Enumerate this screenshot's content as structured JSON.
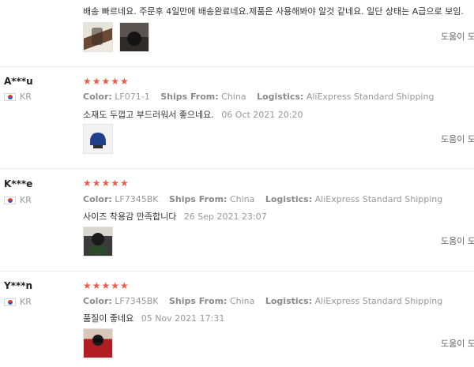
{
  "reviews": [
    {
      "user": "",
      "country": "",
      "attributes": [],
      "text": "배송 빠르네요. 주문후 4일만에 배송완료네요.제품은 사용해봐야 알것 같네요. 일단 상태는 A급으로 보임.",
      "date": "",
      "helpful_label": "도움이 도",
      "photos": [
        "photo-1",
        "photo-2"
      ]
    },
    {
      "user": "A***u",
      "country": "KR",
      "stars": "★★★★★",
      "attributes": [
        {
          "key": "Color:",
          "value": "LF071-1"
        },
        {
          "key": "Ships From:",
          "value": "China"
        },
        {
          "key": "Logistics:",
          "value": "AliExpress Standard Shipping"
        }
      ],
      "text": "소재도 두껍고 부드러워서 좋으네요.",
      "date": "06 Oct 2021 20:20",
      "helpful_label": "도움이 도",
      "photos": [
        "photo-1"
      ]
    },
    {
      "user": "K***e",
      "country": "KR",
      "stars": "★★★★★",
      "attributes": [
        {
          "key": "Color:",
          "value": "LF7345BK"
        },
        {
          "key": "Ships From:",
          "value": "China"
        },
        {
          "key": "Logistics:",
          "value": "AliExpress Standard Shipping"
        }
      ],
      "text": "사이즈 착용감 만족합니다",
      "date": "26 Sep 2021 23:07",
      "helpful_label": "도움이 도",
      "photos": [
        "photo-1"
      ]
    },
    {
      "user": "Y***n",
      "country": "KR",
      "stars": "★★★★★",
      "attributes": [
        {
          "key": "Color:",
          "value": "LF7345BK"
        },
        {
          "key": "Ships From:",
          "value": "China"
        },
        {
          "key": "Logistics:",
          "value": "AliExpress Standard Shipping"
        }
      ],
      "text": "품질이 좋네요",
      "date": "05 Nov 2021 17:31",
      "helpful_label": "도움이 도",
      "photos": [
        "photo-1"
      ]
    }
  ],
  "colors": {
    "star": "#f05a46",
    "muted": "#999999",
    "divider": "#ececec"
  }
}
